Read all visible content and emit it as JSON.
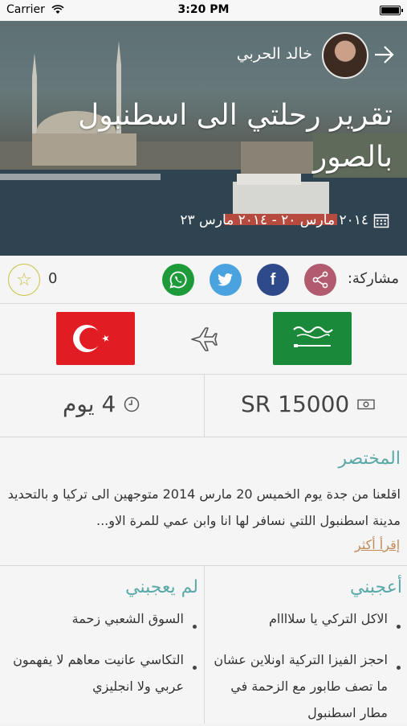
{
  "status_bar": {
    "carrier": "Carrier",
    "time": "3:20 PM"
  },
  "trip": {
    "author": "خالد الحربي",
    "title": "تقرير رحلتي الى اسطنبول بالصور",
    "dates": "٢٠١٤ مارس ٢٠ - ٢٠١٤ مارس ٢٣"
  },
  "share": {
    "label": "مشاركة:",
    "favorites_count": "0"
  },
  "stats": {
    "cost": "SR 15000",
    "duration": "4 يوم"
  },
  "summary": {
    "heading": "المختصر",
    "text": "اقلعنا من جدة يوم الخميس 20 مارس 2014 متوجهين الى تركيا و بالتحديد مدينة اسطنبول اللتي نسافر لها انا وابن عمي للمرة الاو...",
    "read_more": "إقرأ أكثر"
  },
  "liked": {
    "heading": "أعجبني",
    "items": [
      "الاكل التركي يا سلاااام",
      "احجز الفيزا التركية اونلاين عشان ما تصف طابور مع الزحمة في مطار اسطنبول"
    ]
  },
  "disliked": {
    "heading": "لم يعجبني",
    "items": [
      "السوق الشعبي زحمة",
      "التكاسي عانيت معاهم لا يفهمون عربي ولا انجليزي"
    ]
  },
  "colors": {
    "accent": "#5aa9a8",
    "share": "#b25b6e",
    "facebook": "#2e4a8a",
    "twitter": "#4aa3df",
    "whatsapp": "#1d9b3a",
    "flag_turkey": "#e21c23",
    "flag_saudi": "#1a8a3a"
  }
}
